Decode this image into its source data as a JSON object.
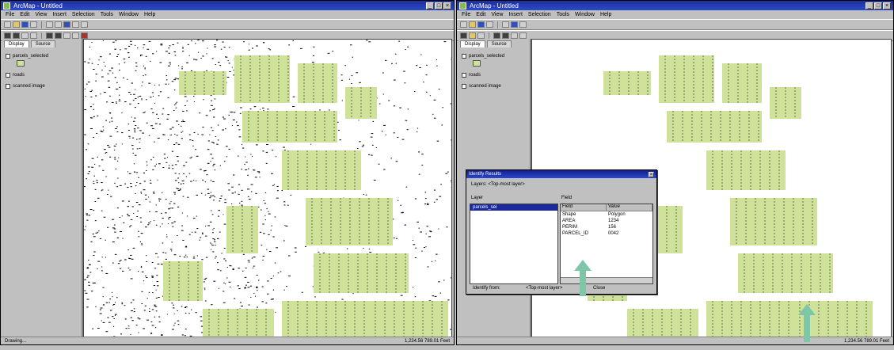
{
  "left_window": {
    "title": "ArcMap - Untitled",
    "menus": [
      "File",
      "Edit",
      "View",
      "Insert",
      "Selection",
      "Tools",
      "Window",
      "Help"
    ],
    "toc_tabs": [
      "Display",
      "Source"
    ],
    "layers": [
      {
        "label": "parcels_selected",
        "checked": true,
        "has_swatch": true
      },
      {
        "label": "roads",
        "checked": true,
        "has_swatch": false
      },
      {
        "label": "scanned image",
        "checked": false,
        "has_swatch": false
      }
    ],
    "status_left": "Drawing...",
    "status_right": "1,234.56  789.01 Feet"
  },
  "right_window": {
    "title": "ArcMap - Untitled",
    "menus": [
      "File",
      "Edit",
      "View",
      "Insert",
      "Selection",
      "Tools",
      "Window",
      "Help"
    ],
    "toc_tabs": [
      "Display",
      "Source"
    ],
    "layers": [
      {
        "label": "parcels_selected",
        "checked": true,
        "has_swatch": true
      },
      {
        "label": "roads",
        "checked": true,
        "has_swatch": false
      },
      {
        "label": "scanned image",
        "checked": false,
        "has_swatch": false
      }
    ],
    "status_left": "",
    "status_right": "1,234.56  789.01 Feet"
  },
  "dialog": {
    "title": "Identify Results",
    "layers_label": "Layers: <Top-most layer>",
    "left_label": "Layer",
    "right_label": "Field",
    "list_items": [
      "parcels_sel"
    ],
    "table_headers": [
      "Field",
      "Value"
    ],
    "table_rows": [
      [
        "Shape",
        "Polygon"
      ],
      [
        "AREA",
        "1234"
      ],
      [
        "PERIM",
        "156"
      ],
      [
        "PARCEL_ID",
        "0042"
      ]
    ],
    "buttons": [
      "Identify from:",
      "<Top-most layer>",
      "Close"
    ]
  },
  "colors": {
    "parcel_fill": "#cfe29a",
    "arrow": "#7fc6a8",
    "titlebar": "#1f2f9a"
  }
}
